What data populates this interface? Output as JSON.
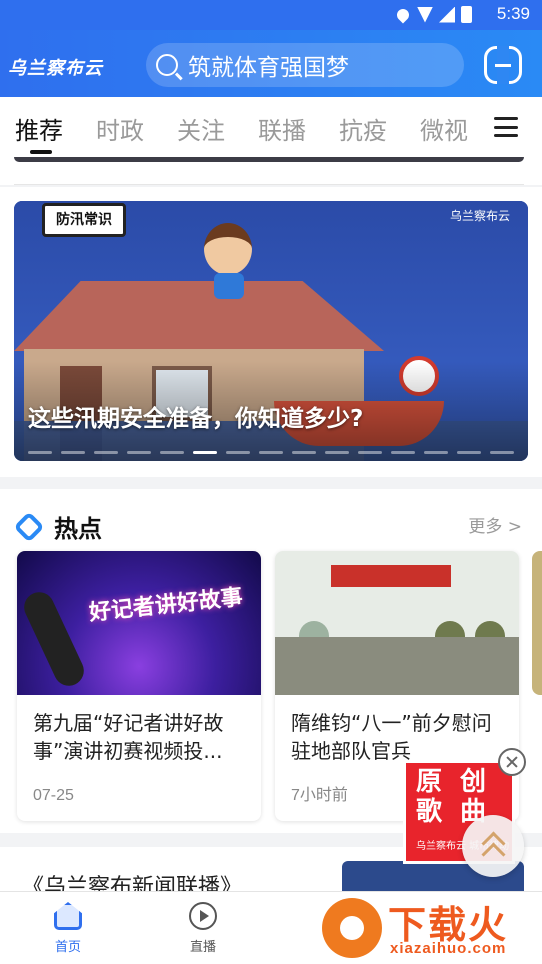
{
  "status_bar": {
    "time": "5:39"
  },
  "header": {
    "app_logo": "乌兰察布云",
    "search_text": "筑就体育强国梦",
    "scan_icon": "scan-icon"
  },
  "tabs": [
    {
      "label": "推荐",
      "active": true
    },
    {
      "label": "时政"
    },
    {
      "label": "关注"
    },
    {
      "label": "联播"
    },
    {
      "label": "抗疫"
    },
    {
      "label": "微视"
    }
  ],
  "banner": {
    "tag": "防汛常识",
    "brand": "乌兰察布云",
    "caption": "这些汛期安全准备，你知道多少?",
    "page_count": 15,
    "active_index": 5
  },
  "hot": {
    "title": "热点",
    "more": "更多 >",
    "items": [
      {
        "thumb_text": "好记者讲好故事",
        "title": "第九届“好记者讲好故事”演讲初赛视频投...",
        "date": "07-25"
      },
      {
        "title": "隋维钧“八一”前夕慰问驻地部队官兵",
        "date": "7小时前"
      }
    ]
  },
  "next_item": {
    "title": "《乌兰察布新闻联播》"
  },
  "promo": {
    "title": "原创歌曲",
    "subtitle": "乌兰察布云 城市律动"
  },
  "bottom_nav": [
    {
      "label": "首页",
      "active": true
    },
    {
      "label": "直播"
    }
  ],
  "watermark": {
    "big": "下载火",
    "small": "xiazaihuo.com"
  },
  "colors": {
    "brand_blue": "#2f6fee",
    "promo_red": "#e8242c",
    "watermark_orange": "#ee5a1f"
  }
}
